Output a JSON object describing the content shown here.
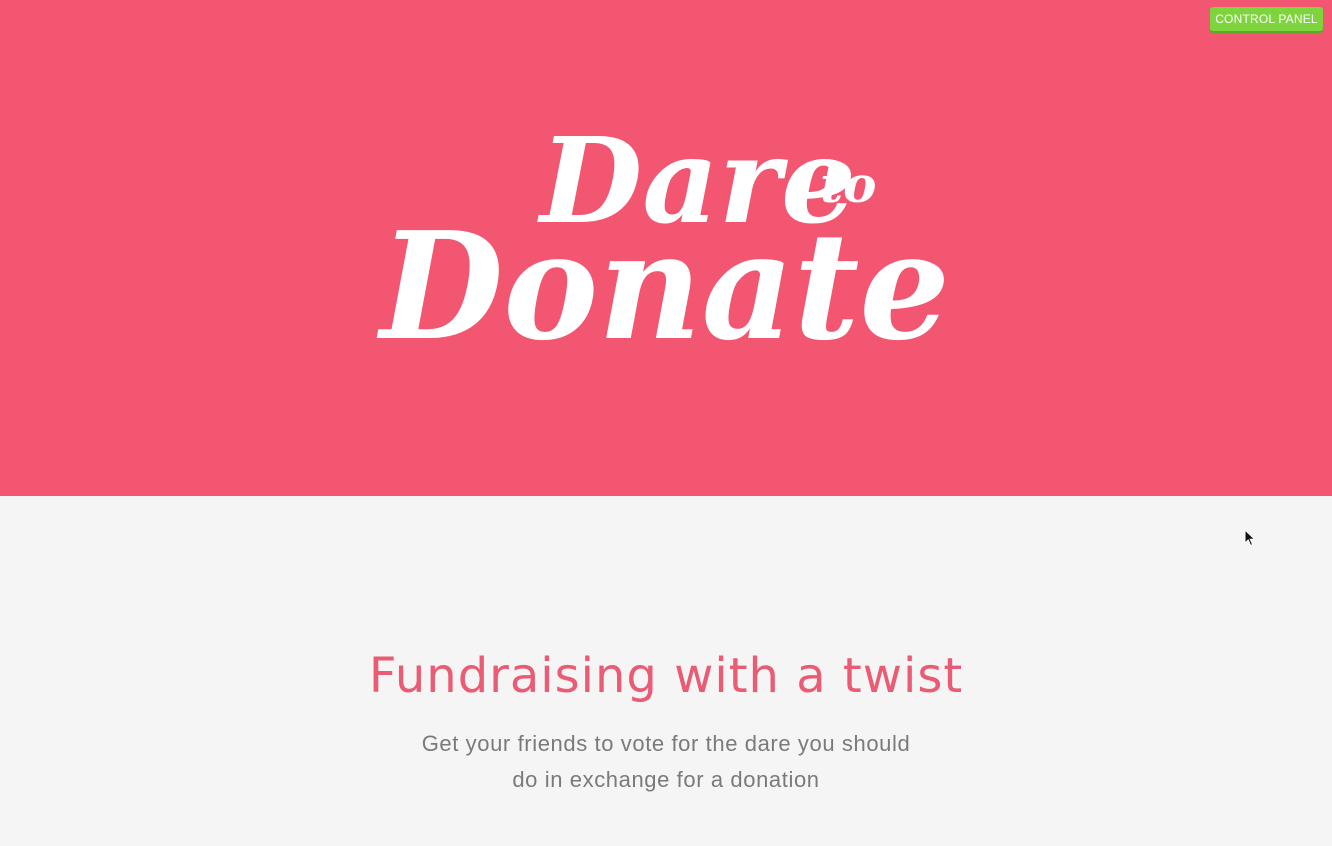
{
  "header": {
    "control_panel_label": "CONTROL PANEL",
    "logo_text": {
      "line1": "Dare",
      "small": "to",
      "line2": "Donate"
    }
  },
  "main": {
    "headline": "Fundraising with a twist",
    "subline_1": "Get your friends to vote for the dare you should",
    "subline_2": "do in exchange for a donation"
  },
  "colors": {
    "hero_bg": "#f25670",
    "page_bg": "#f5f5f5",
    "headline": "#ea5b74",
    "subline": "#7a7a7a",
    "button_green": "#7dd43c"
  },
  "icons": {
    "cursor": "mouse-pointer-icon"
  }
}
